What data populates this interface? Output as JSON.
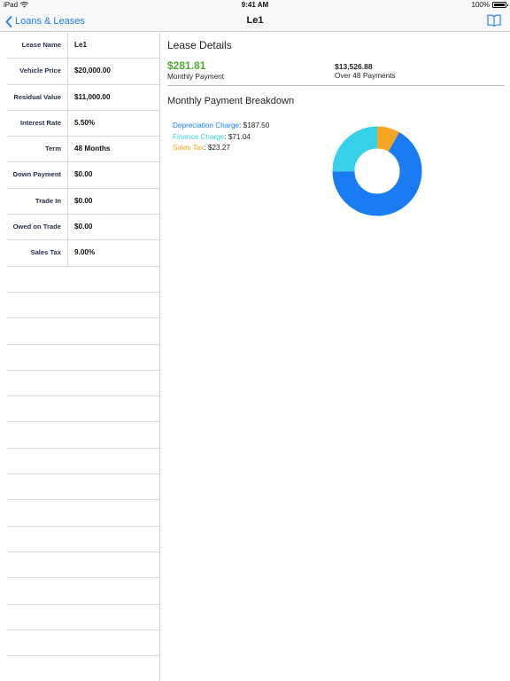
{
  "status_bar": {
    "carrier": "iPad",
    "time": "9:41 AM",
    "battery": "100%"
  },
  "nav": {
    "back_label": "Loans & Leases",
    "title": "Le1",
    "right_icon": "book-icon"
  },
  "inputs": [
    {
      "label": "Lease Name",
      "value": "Le1"
    },
    {
      "label": "Vehicle Price",
      "value": "$20,000.00"
    },
    {
      "label": "Residual Value",
      "value": "$11,000.00"
    },
    {
      "label": "Interest Rate",
      "value": "5.50%"
    },
    {
      "label": "Term",
      "value": "48 Months"
    },
    {
      "label": "Down Payment",
      "value": "$0.00"
    },
    {
      "label": "Trade In",
      "value": "$0.00"
    },
    {
      "label": "Owed on Trade",
      "value": "$0.00"
    },
    {
      "label": "Sales Tax",
      "value": "9.00%"
    }
  ],
  "details": {
    "heading": "Lease Details",
    "monthly_amount": "$281.81",
    "monthly_caption": "Monthly Payment",
    "total_amount": "$13,526.88",
    "total_caption": "Over 48 Payments"
  },
  "breakdown": {
    "heading": "Monthly Payment Breakdown",
    "items": [
      {
        "name": "Depreciation Charge",
        "value": ": $187.50",
        "amount": 187.5,
        "color": "#1a7cf3"
      },
      {
        "name": "Finance Charge",
        "value": ": $71.04",
        "amount": 71.04,
        "color": "#37d2e9"
      },
      {
        "name": "Sales Tax",
        "value": ": $23.27",
        "amount": 23.27,
        "color": "#f5a623"
      }
    ]
  }
}
